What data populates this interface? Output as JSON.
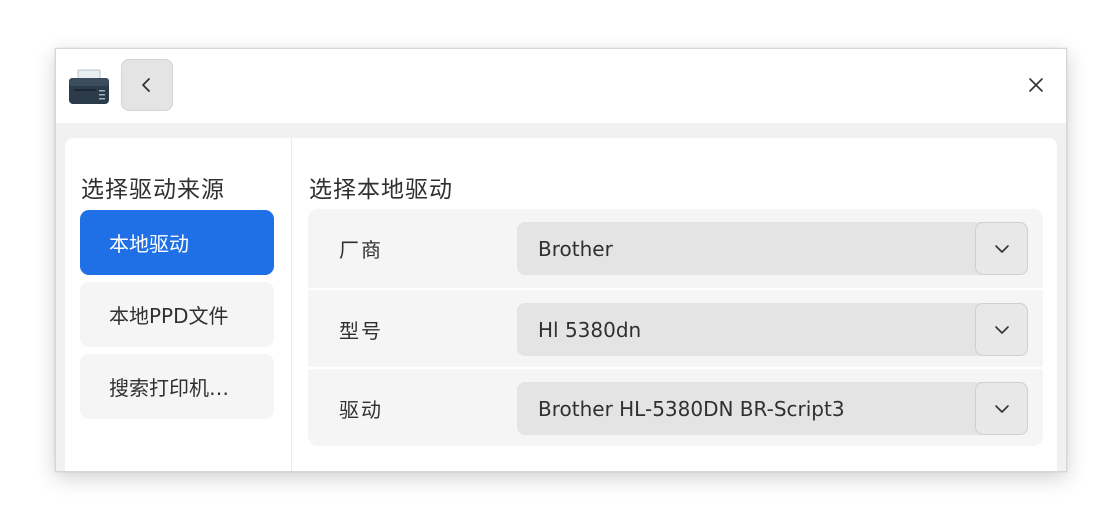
{
  "titlebar": {
    "app_icon": "printer-icon",
    "back_icon": "chevron-left-icon",
    "close_icon": "close-icon"
  },
  "sidebar": {
    "title": "选择驱动来源",
    "items": [
      {
        "label": "本地驱动",
        "selected": true
      },
      {
        "label": "本地PPD文件",
        "selected": false
      },
      {
        "label": "搜索打印机…",
        "selected": false
      }
    ]
  },
  "main": {
    "title": "选择本地驱动",
    "fields": [
      {
        "label": "厂商",
        "value": "Brother"
      },
      {
        "label": "型号",
        "value": "Hl 5380dn"
      },
      {
        "label": "驱动",
        "value": "Brother HL-5380DN BR-Script3"
      }
    ]
  },
  "colors": {
    "accent": "#1f6fe6",
    "window_bg": "#f1f1f1",
    "select_bg": "#e4e4e4"
  }
}
